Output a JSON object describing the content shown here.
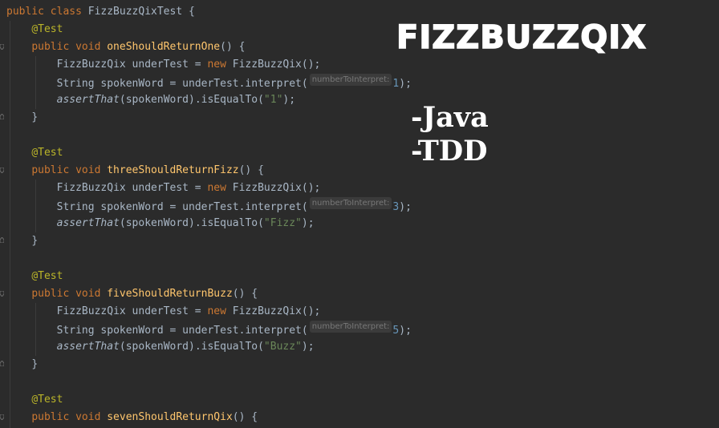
{
  "code": {
    "class_keywords": "public class",
    "class_name": "FizzBuzzQixTest",
    "open_brace": " {",
    "close_brace": "}",
    "annotation": "@Test",
    "method_modifiers": "public void",
    "paren_open": "() {",
    "var_type_1": "FizzBuzzQix",
    "var_decl_1": " underTest = ",
    "new_kw": "new",
    "ctor_call": " FizzBuzzQix();",
    "var_type_2": "String",
    "var_decl_2": " spokenWord = underTest.interpret(",
    "param_hint": "numberToInterpret:",
    "close_call": ");",
    "assert_fn": "assertThat",
    "assert_mid": "(spokenWord).isEqualTo(",
    "methods": [
      {
        "name": "oneShouldReturnOne",
        "arg": "1",
        "expected": "\"1\""
      },
      {
        "name": "threeShouldReturnFizz",
        "arg": "3",
        "expected": "\"Fizz\""
      },
      {
        "name": "fiveShouldReturnBuzz",
        "arg": "5",
        "expected": "\"Buzz\""
      },
      {
        "name": "sevenShouldReturnQix"
      }
    ]
  },
  "overlay": {
    "title": "FIZZBUZZQIX",
    "tags": [
      "-Java",
      "-TDD"
    ]
  },
  "colors": {
    "background": "#2b2b2b",
    "keyword": "#cc7832",
    "method_name": "#ffc66d",
    "annotation": "#bbb529",
    "string": "#6a8759",
    "number": "#6897bb",
    "text": "#a9b7c6"
  }
}
